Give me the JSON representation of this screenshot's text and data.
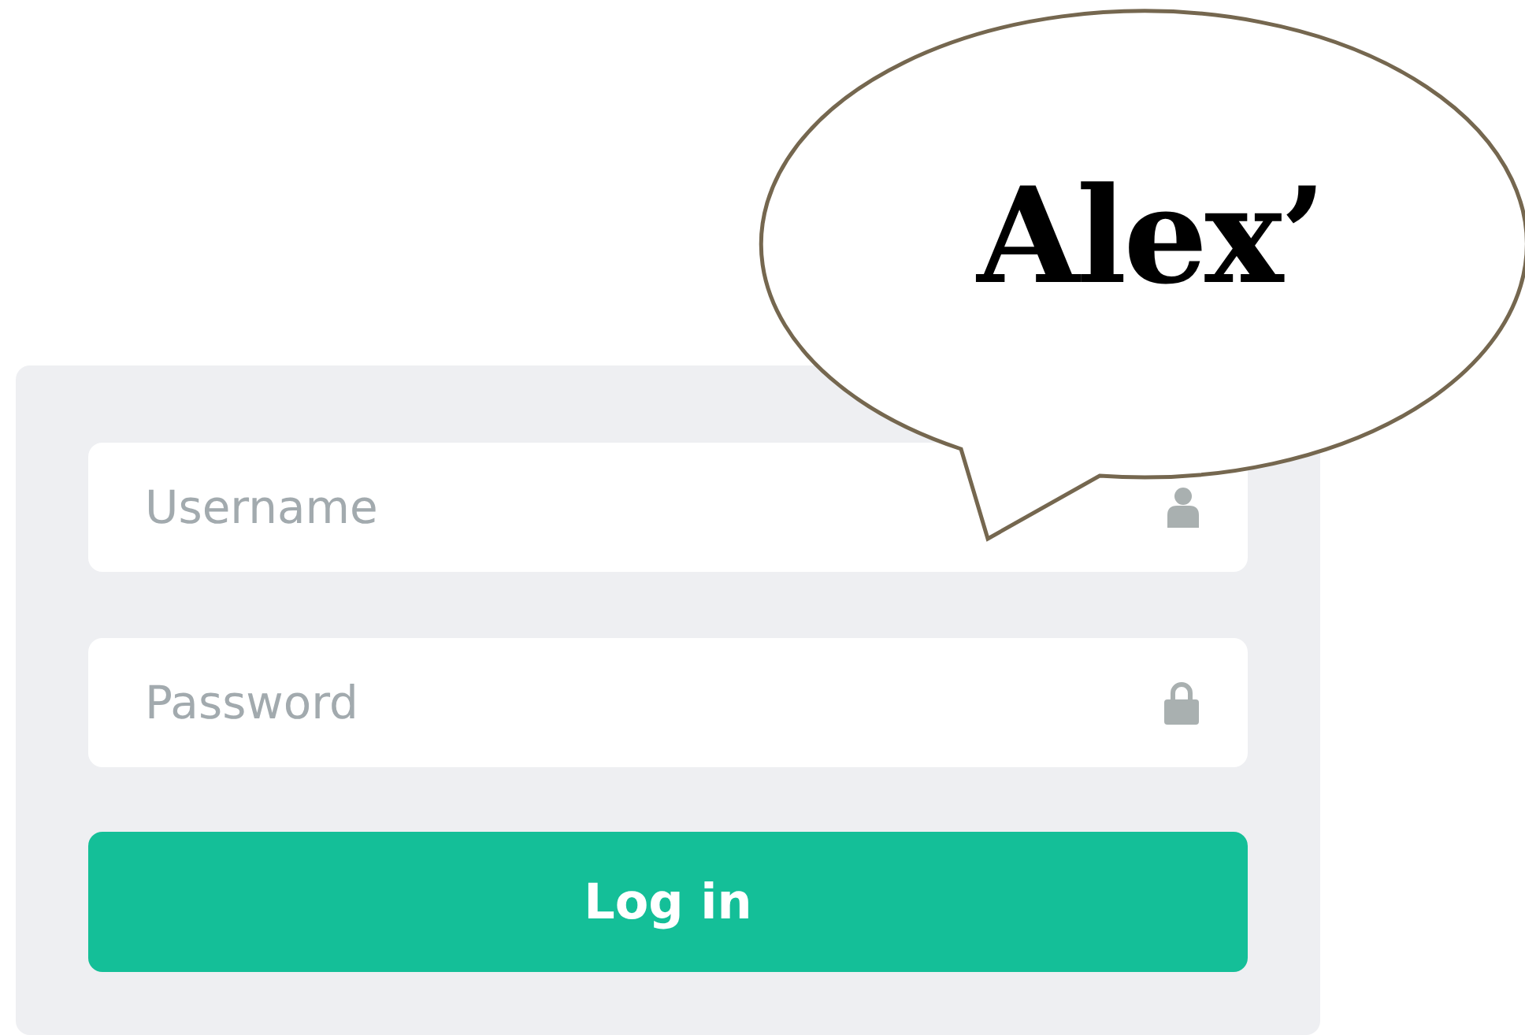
{
  "login_form": {
    "fields": [
      {
        "kind": "user",
        "placeholder": "Username"
      },
      {
        "kind": "password",
        "placeholder": "Password"
      }
    ],
    "button": "Log in"
  },
  "speech_bubble": {
    "text": "Alex’"
  }
}
